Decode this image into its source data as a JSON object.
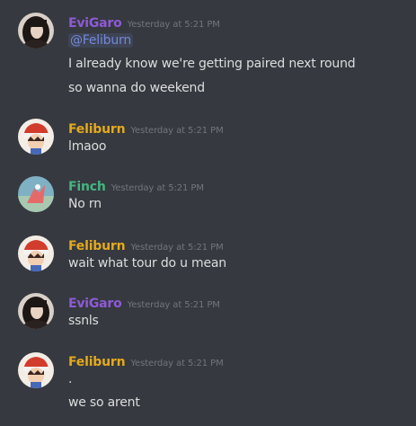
{
  "colors": {
    "background": "#36393f",
    "evigaro": "#8e5ad6",
    "feliburn": "#e4a91d",
    "finch": "#43b581",
    "text": "#dcddde",
    "timestamp": "#72767d",
    "mention": "#7289da"
  },
  "messages": [
    {
      "username": "EviGaro",
      "timestamp": "Yesterday at 5:21 PM",
      "mention": "@Feliburn",
      "lines": [
        "I already know we're getting paired next round",
        "so wanna do weekend"
      ]
    },
    {
      "username": "Feliburn",
      "timestamp": "Yesterday at 5:21 PM",
      "lines": [
        "lmaoo"
      ]
    },
    {
      "username": "Finch",
      "timestamp": "Yesterday at 5:21 PM",
      "lines": [
        "No rn"
      ]
    },
    {
      "username": "Feliburn",
      "timestamp": "Yesterday at 5:21 PM",
      "lines": [
        "wait what tour do u mean"
      ]
    },
    {
      "username": "EviGaro",
      "timestamp": "Yesterday at 5:21 PM",
      "lines": [
        "ssnls"
      ]
    },
    {
      "username": "Feliburn",
      "timestamp": "Yesterday at 5:21 PM",
      "lines": [
        ".",
        "we so arent"
      ]
    }
  ]
}
